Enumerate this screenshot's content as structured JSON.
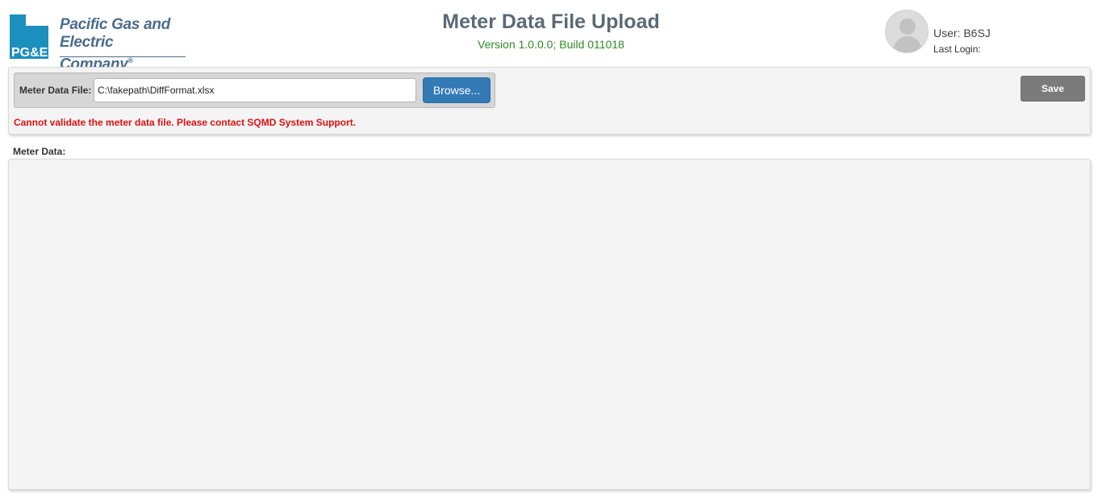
{
  "header": {
    "logo": {
      "mark_text": "PG&E",
      "company_line1": "Pacific Gas and",
      "company_line2": "Electric Company",
      "registered_mark": "®",
      "colors": {
        "blue": "#1b8fbd",
        "yellow": "#f5b41c",
        "text": "#4a6d8c"
      }
    },
    "title": "Meter Data File Upload",
    "version": "Version 1.0.0.0; Build 011018",
    "user": {
      "avatar_icon": "user-silhouette-icon",
      "label": "User: B6SJ",
      "last_login": "Last Login:"
    }
  },
  "toolbar": {
    "file_label": "Meter Data File:",
    "file_value": "C:\\fakepath\\DiffFormat.xlsx",
    "browse_label": "Browse...",
    "save_label": "Save",
    "error_message": "Cannot validate the meter data file. Please contact SQMD System Support."
  },
  "meter_data": {
    "label": "Meter Data:"
  },
  "colors": {
    "title": "#5a6a76",
    "version": "#2e8b22",
    "browse_button": "#337ab7",
    "save_button": "#7b7b7b",
    "error": "#dd1111"
  }
}
